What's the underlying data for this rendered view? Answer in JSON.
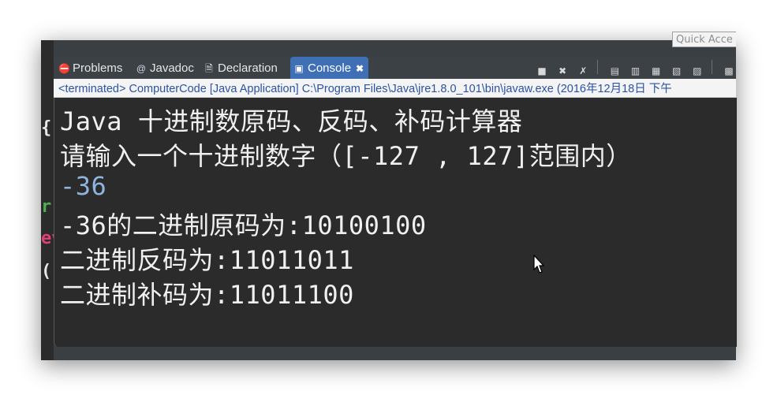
{
  "quick_access": {
    "label": "Quick Acce"
  },
  "tabs": [
    {
      "label": "Problems",
      "icon": "problems-icon"
    },
    {
      "label": "Javadoc",
      "icon": "javadoc-icon"
    },
    {
      "label": "Declaration",
      "icon": "declaration-icon"
    },
    {
      "label": "Console",
      "icon": "console-icon",
      "active": true
    }
  ],
  "status": {
    "text": "<terminated> ComputerCode [Java Application] C:\\Program Files\\Java\\jre1.8.0_101\\bin\\javaw.exe (2016年12月18日 下午"
  },
  "console": {
    "lines": [
      "Java 十进制数原码、反码、补码计算器",
      "请输入一个十进制数字（[-127 , 127]范围内）",
      "-36",
      "-36的二进制原码为:10100100",
      "二进制反码为:11011011",
      "二进制补码为:11011100"
    ]
  },
  "gutter": [
    "{",
    "r",
    "ev",
    "("
  ],
  "colors": {
    "console_bg": "#2b2b2b",
    "console_text": "#f0f0f0",
    "input_text": "#8fb4e0",
    "status_text": "#2a52a8",
    "active_tab": "#3f6fb4"
  }
}
